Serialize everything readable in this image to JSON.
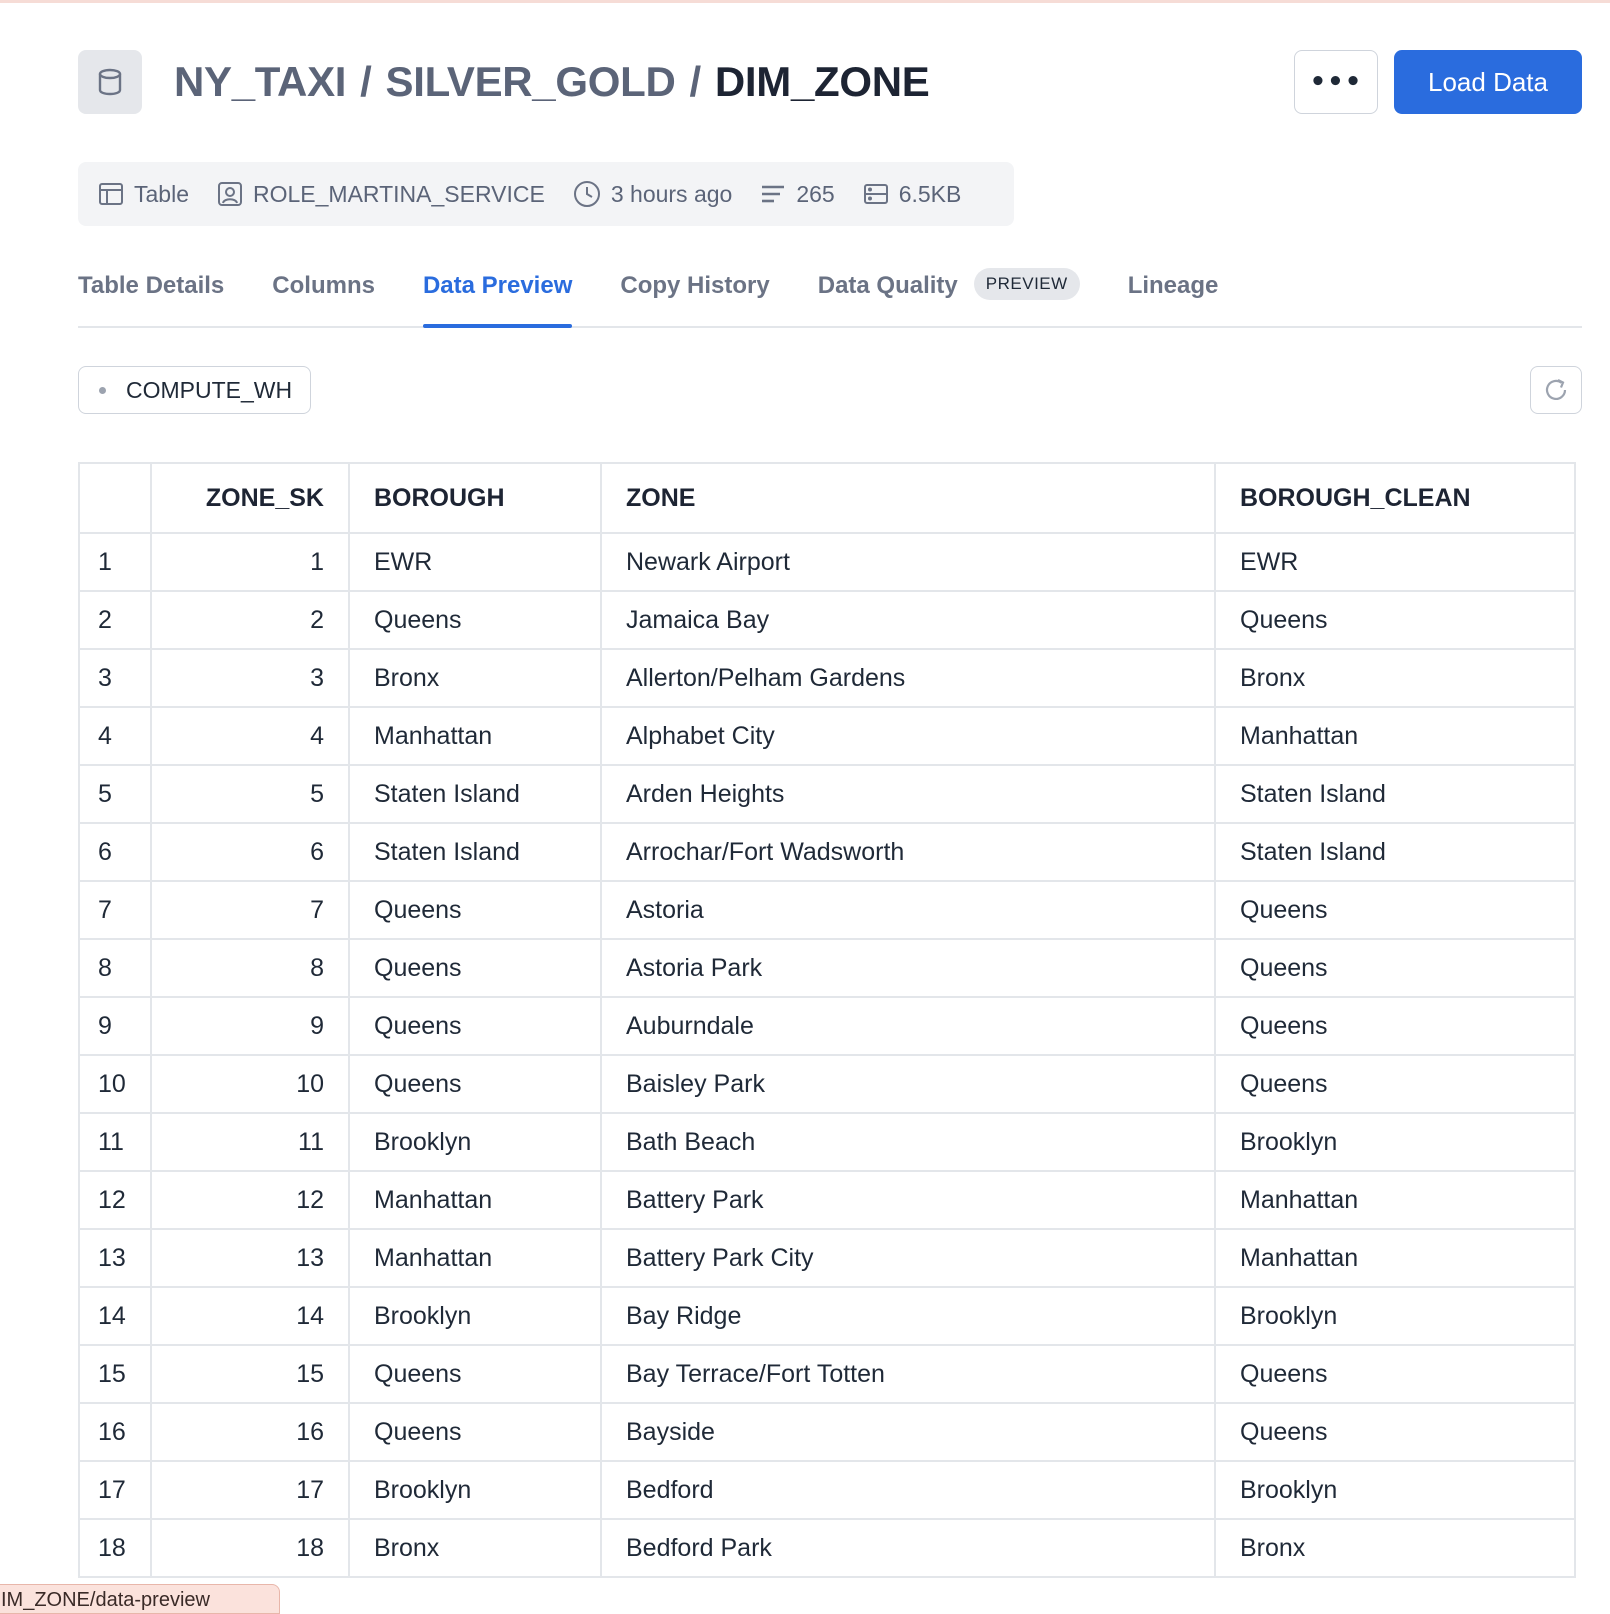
{
  "header": {
    "breadcrumb": [
      "NY_TAXI",
      "SILVER_GOLD"
    ],
    "separator": "/",
    "current": "DIM_ZONE",
    "more_label": "•••",
    "load_label": "Load Data"
  },
  "meta": {
    "type": "Table",
    "owner": "ROLE_MARTINA_SERVICE",
    "updated": "3 hours ago",
    "rows": "265",
    "size": "6.5KB"
  },
  "tabs": [
    {
      "label": "Table Details"
    },
    {
      "label": "Columns"
    },
    {
      "label": "Data Preview",
      "active": true
    },
    {
      "label": "Copy History"
    },
    {
      "label": "Data Quality",
      "badge": "PREVIEW"
    },
    {
      "label": "Lineage"
    }
  ],
  "warehouse": "COMPUTE_WH",
  "table": {
    "columns": [
      "",
      "ZONE_SK",
      "BOROUGH",
      "ZONE",
      "BOROUGH_CLEAN"
    ],
    "rows": [
      [
        "1",
        "1",
        "EWR",
        "Newark Airport",
        "EWR"
      ],
      [
        "2",
        "2",
        "Queens",
        "Jamaica Bay",
        "Queens"
      ],
      [
        "3",
        "3",
        "Bronx",
        "Allerton/Pelham Gardens",
        "Bronx"
      ],
      [
        "4",
        "4",
        "Manhattan",
        "Alphabet City",
        "Manhattan"
      ],
      [
        "5",
        "5",
        "Staten Island",
        "Arden Heights",
        "Staten Island"
      ],
      [
        "6",
        "6",
        "Staten Island",
        "Arrochar/Fort Wadsworth",
        "Staten Island"
      ],
      [
        "7",
        "7",
        "Queens",
        "Astoria",
        "Queens"
      ],
      [
        "8",
        "8",
        "Queens",
        "Astoria Park",
        "Queens"
      ],
      [
        "9",
        "9",
        "Queens",
        "Auburndale",
        "Queens"
      ],
      [
        "10",
        "10",
        "Queens",
        "Baisley Park",
        "Queens"
      ],
      [
        "11",
        "11",
        "Brooklyn",
        "Bath Beach",
        "Brooklyn"
      ],
      [
        "12",
        "12",
        "Manhattan",
        "Battery Park",
        "Manhattan"
      ],
      [
        "13",
        "13",
        "Manhattan",
        "Battery Park City",
        "Manhattan"
      ],
      [
        "14",
        "14",
        "Brooklyn",
        "Bay Ridge",
        "Brooklyn"
      ],
      [
        "15",
        "15",
        "Queens",
        "Bay Terrace/Fort Totten",
        "Queens"
      ],
      [
        "16",
        "16",
        "Queens",
        "Bayside",
        "Queens"
      ],
      [
        "17",
        "17",
        "Brooklyn",
        "Bedford",
        "Brooklyn"
      ],
      [
        "18",
        "18",
        "Bronx",
        "Bedford Park",
        "Bronx"
      ]
    ]
  },
  "status_url": "IM_ZONE/data-preview"
}
